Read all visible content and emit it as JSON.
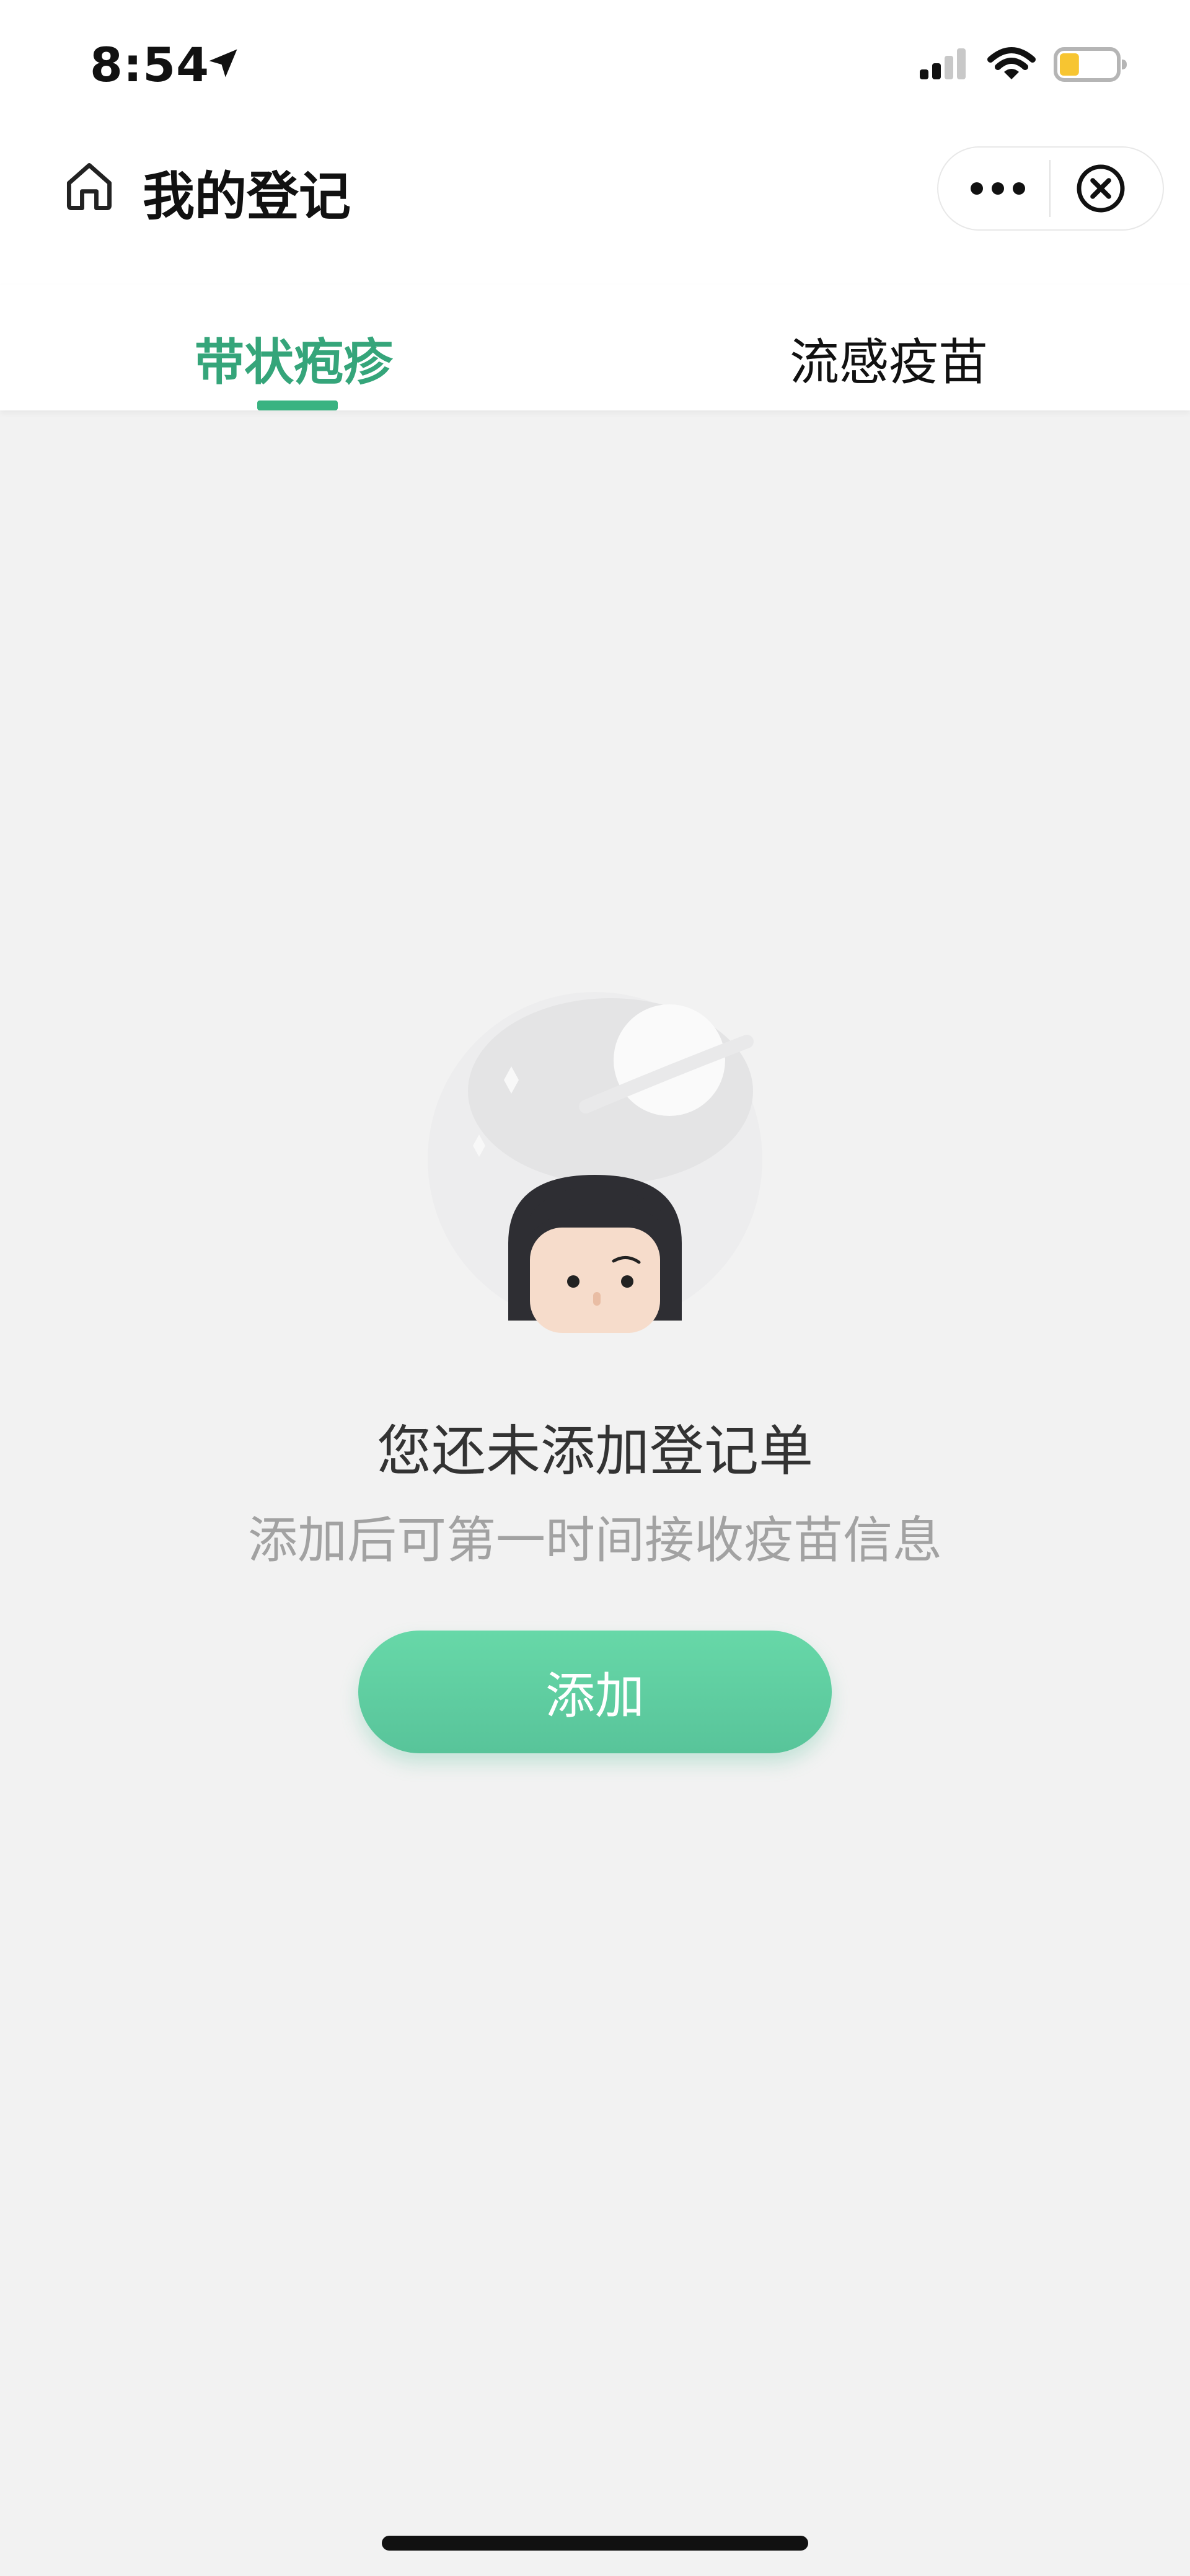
{
  "status_bar": {
    "time": "8:54",
    "icons": [
      "location-arrow-icon",
      "signal-icon",
      "wifi-icon",
      "battery-icon"
    ],
    "battery_level": 0.35,
    "battery_color": "#f7c531"
  },
  "nav": {
    "title": "我的登记",
    "icons": [
      "home-icon",
      "more-icon",
      "close-icon"
    ]
  },
  "tabs": [
    {
      "label": "带状疱疹",
      "active": true
    },
    {
      "label": "流感疫苗",
      "active": false
    }
  ],
  "empty_state": {
    "title": "您还未添加登记单",
    "subtitle": "添加后可第一时间接收疫苗信息",
    "illustration_icon": "empty-state-girl-planet-illustration"
  },
  "add_button": {
    "label": "添加"
  },
  "colors": {
    "accent": "#35a57a",
    "button": "#62d0a3",
    "background": "#f2f2f2"
  }
}
